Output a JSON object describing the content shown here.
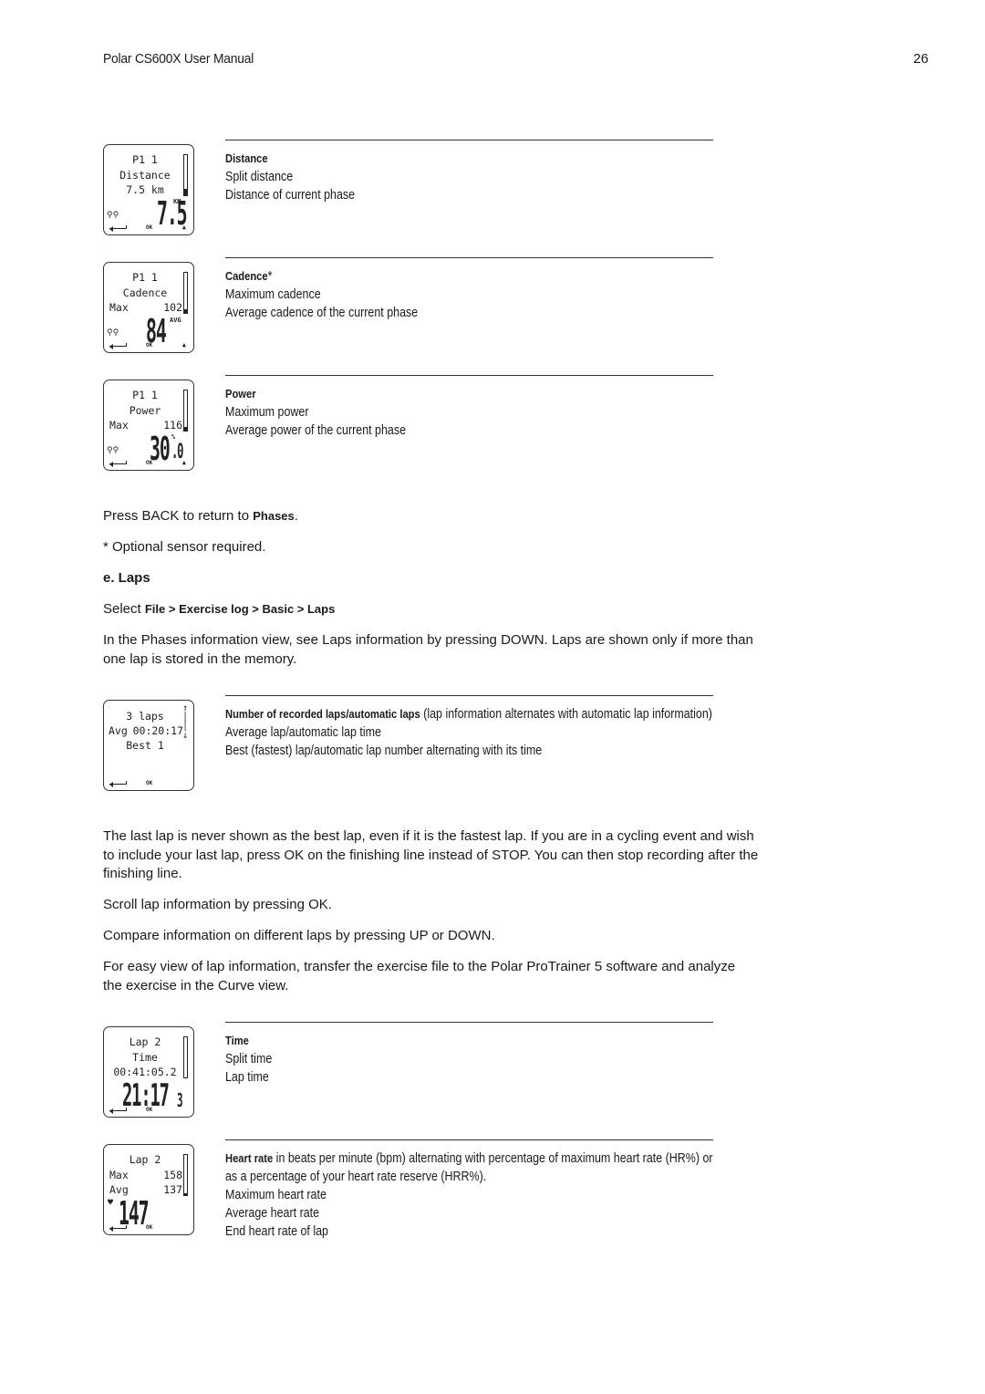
{
  "header": {
    "title": "Polar CS600X User Manual",
    "page_number": "26"
  },
  "phase_screens": [
    {
      "lcd": {
        "line1": "P1 1",
        "line2": "Distance",
        "line3": "7.5 km",
        "big_value": "7.5",
        "big_unit": "KM",
        "ok_label": "OK",
        "bar_fill": 0.15
      },
      "title": "Distance",
      "title_suffix": "",
      "lines": [
        "Split distance",
        "Distance of current phase"
      ]
    },
    {
      "lcd": {
        "line1": "P1 1",
        "line2": "Cadence",
        "line3_left": "Max",
        "line3_right": "102",
        "big_value": "84",
        "big_unit": "AVG",
        "ok_label": "OK",
        "bar_fill": 0.1
      },
      "title": "Cadence",
      "title_suffix": "*",
      "lines": [
        "Maximum cadence",
        "Average cadence of the current phase"
      ]
    },
    {
      "lcd": {
        "line1": "P1 1",
        "line2": "Power",
        "line3_left": "Max",
        "line3_right": "116",
        "big_value": "30",
        "big_unit": "%",
        "big_decimal": ".0",
        "ok_label": "OK",
        "bar_fill": 0.1
      },
      "title": "Power",
      "title_suffix": "",
      "lines": [
        "Maximum power",
        "Average power of the current phase"
      ]
    }
  ],
  "back_note": {
    "prefix": "Press BACK to return to ",
    "target": "Phases",
    "suffix": "."
  },
  "sensor_note": "* Optional sensor required.",
  "laps_section": {
    "heading": "e. Laps",
    "select_prefix": "Select ",
    "select_path": "File > Exercise log > Basic > Laps",
    "intro": "In the Phases information view, see Laps information by pressing DOWN. Laps are shown only if more than one lap is stored in the memory."
  },
  "laps_screen": {
    "lcd": {
      "line1": "3 laps",
      "line2_left": "Avg",
      "line2_right": "00:20:17",
      "line3": "Best 1",
      "ok_label": "OK"
    },
    "title": "Number of recorded laps/automatic laps",
    "title_rest": " (lap information alternates with automatic lap information)",
    "lines": [
      "Average lap/automatic lap time",
      "Best (fastest) lap/automatic lap number alternating with its time"
    ]
  },
  "paragraphs": [
    "The last lap is never shown as the best lap, even if it is the fastest lap. If you are in a cycling event and wish to include your last lap, press OK on the finishing line instead of STOP. You can then stop recording after the finishing line.",
    "Scroll lap information by pressing OK.",
    "Compare information on different laps by pressing UP or DOWN.",
    "For easy view of lap information, transfer the exercise file to the Polar ProTrainer 5 software and analyze the exercise in the Curve view."
  ],
  "lap_screens": [
    {
      "lcd": {
        "line1": "Lap 2",
        "line2": "Time",
        "line3": "00:41:05.2",
        "big_value": "21:17",
        "big_decimal": "3",
        "ok_label": "OK",
        "bar_fill": 0.0
      },
      "title": "Time",
      "title_rest": "",
      "lines": [
        "Split time",
        "Lap time"
      ]
    },
    {
      "lcd": {
        "line1": "Lap 2",
        "line2_left": "Max",
        "line2_right": "158",
        "line3_left": "Avg",
        "line3_right": "137",
        "big_value": "147",
        "ok_label": "OK",
        "bar_fill": 0.05
      },
      "title": "Heart rate",
      "title_rest": " in beats per minute (bpm) alternating with percentage of maximum heart rate (HR%) or as a percentage of your heart rate reserve (HRR%).",
      "lines": [
        "Maximum heart rate",
        "Average heart rate",
        "End heart rate of lap"
      ]
    }
  ]
}
